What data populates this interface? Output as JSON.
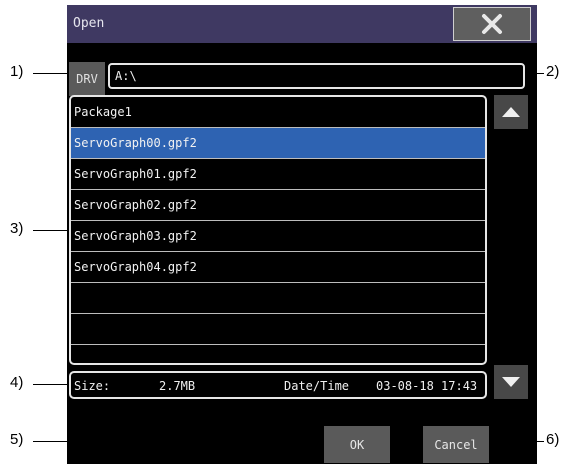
{
  "window": {
    "title": "Open"
  },
  "drive": {
    "label": "DRV",
    "path": "A:\\"
  },
  "files": {
    "rows": [
      "Package1",
      "ServoGraph00.gpf2",
      "ServoGraph01.gpf2",
      "ServoGraph02.gpf2",
      "ServoGraph03.gpf2",
      "ServoGraph04.gpf2",
      "",
      "",
      ""
    ],
    "selected_index": 1
  },
  "info": {
    "size_label": "Size:",
    "size_value": "2.7MB",
    "date_label": "Date/Time",
    "date_value": "03-08-18 17:43"
  },
  "buttons": {
    "ok": "OK",
    "cancel": "Cancel"
  },
  "callouts": [
    "1)",
    "2)",
    "3)",
    "4)",
    "5)",
    "6)"
  ],
  "icons": {
    "close": "close-x-icon",
    "up": "triangle-up-icon",
    "down": "triangle-down-icon"
  },
  "colors": {
    "title_bar": "#3f3962",
    "selection": "#2e63b2",
    "screen": "#000000"
  }
}
